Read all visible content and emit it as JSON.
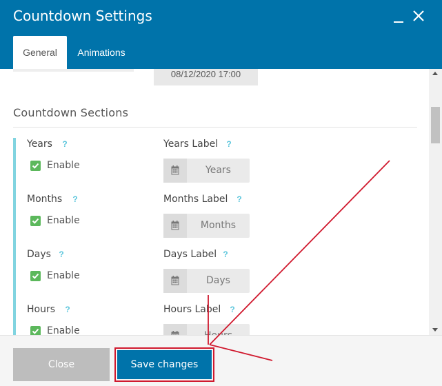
{
  "dialog": {
    "title": "Countdown Settings"
  },
  "tabs": [
    {
      "label": "General",
      "active": true
    },
    {
      "label": "Animations",
      "active": false
    }
  ],
  "date_field": {
    "value": "08/12/2020 17:00"
  },
  "section": {
    "title": "Countdown Sections",
    "help_glyph": "?",
    "enable_label": "Enable",
    "rows": [
      {
        "name": "Years",
        "enabled": true,
        "label_title": "Years Label",
        "label_value": "Years"
      },
      {
        "name": "Months",
        "enabled": true,
        "label_title": "Months Label",
        "label_value": "Months"
      },
      {
        "name": "Days",
        "enabled": true,
        "label_title": "Days Label",
        "label_value": "Days"
      },
      {
        "name": "Hours",
        "enabled": true,
        "label_title": "Hours Label",
        "label_value": "Hours"
      }
    ]
  },
  "footer": {
    "close_label": "Close",
    "save_label": "Save changes"
  },
  "colors": {
    "header": "#0073aa",
    "accent_bar": "#81d4e0",
    "check": "#5cb85c",
    "help": "#5bc6dc",
    "annotation": "#d0192e",
    "close_button": "#bdbdbd",
    "save_button": "#0073aa"
  },
  "icons": {
    "minimize": "minimize-icon",
    "close": "close-icon",
    "help": "help-icon",
    "checkbox": "checkbox-checked-icon",
    "calendar": "calendar-icon"
  }
}
